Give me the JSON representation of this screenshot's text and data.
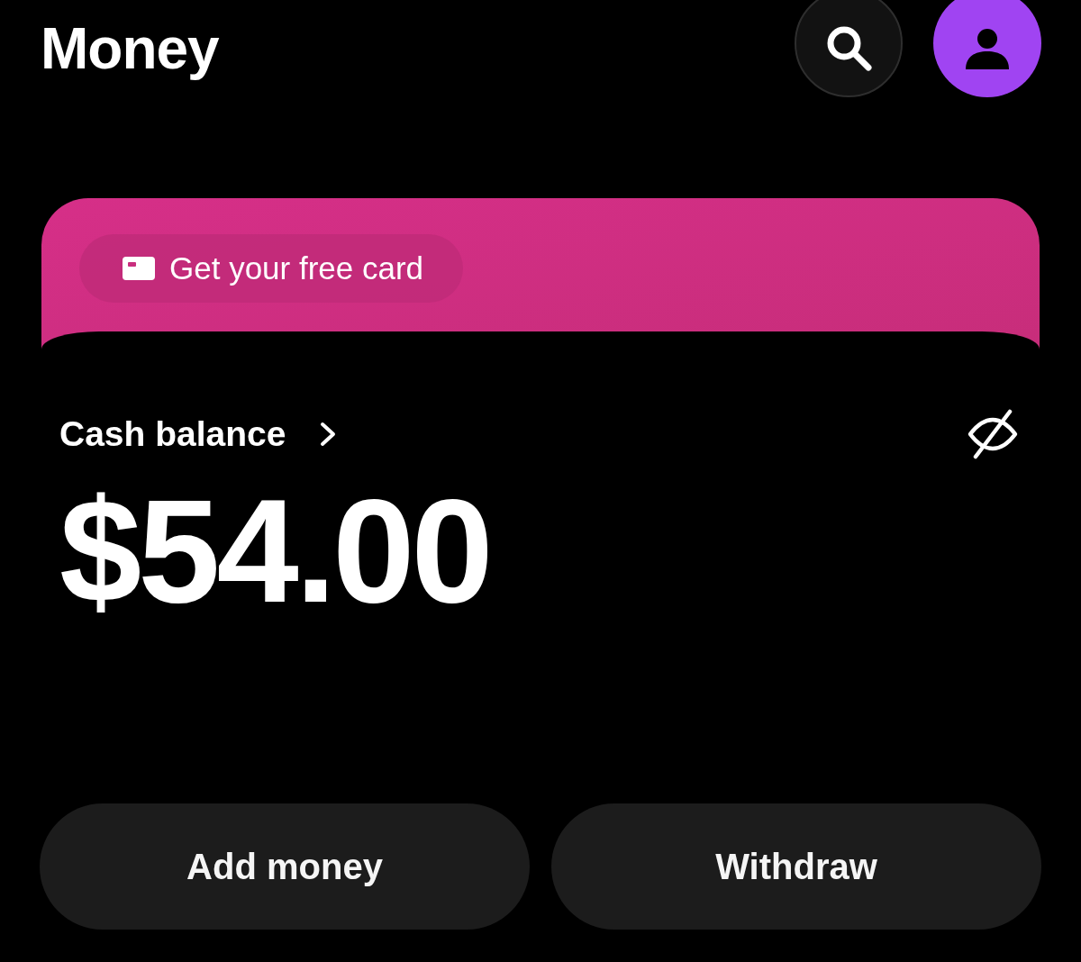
{
  "header": {
    "title": "Money"
  },
  "promo": {
    "label": "Get your free card"
  },
  "balance": {
    "label": "Cash balance",
    "amount": "$54.00"
  },
  "actions": [
    {
      "label": "Add money"
    },
    {
      "label": "Withdraw"
    }
  ]
}
